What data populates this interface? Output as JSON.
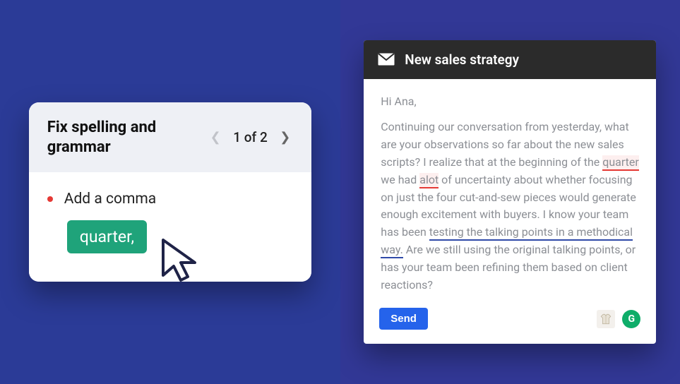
{
  "suggestion": {
    "title": "Fix spelling and grammar",
    "pager_label": "1 of 2",
    "bullet_text": "Add a comma",
    "fix_label": "quarter,"
  },
  "email": {
    "subject": "New sales strategy",
    "greeting": "Hi Ana,",
    "body_pre": "Continuing our conversation from yesterday, what are your observations so far about the new sales scripts? I realize that at the beginning of the ",
    "hl_quarter": "quarter",
    "body_mid1": " we had ",
    "hl_alot": "alot",
    "body_mid2": " of uncertainty about whether focusing on just the four cut-and-sew pieces would generate enough excitement with buyers. I know your team has been ",
    "hl_testing": "testing the talking points in a methodical way.",
    "body_post": " Are we still using the original talking points, or has your team been refining them based on client reactions?",
    "send_label": "Send",
    "g_label": "G"
  }
}
